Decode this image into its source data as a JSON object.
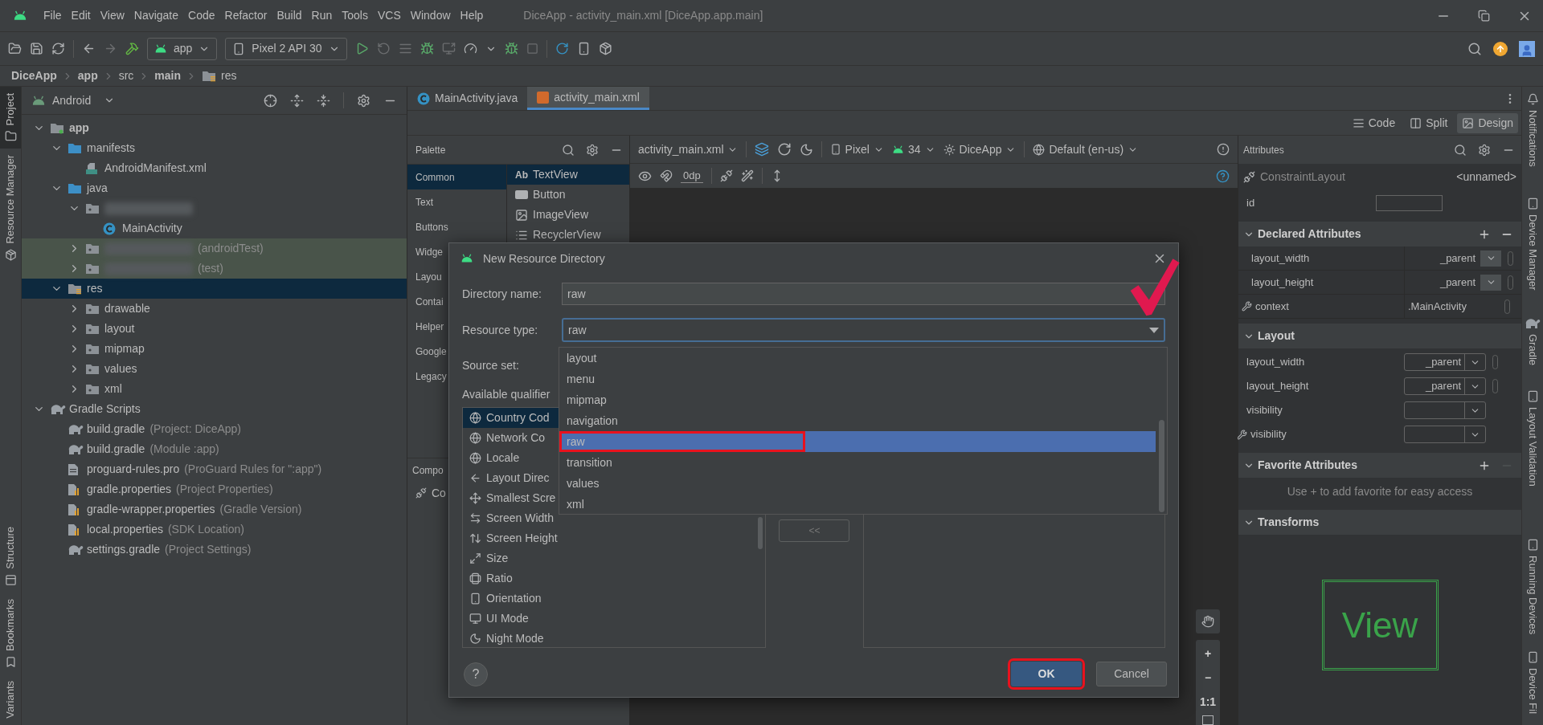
{
  "menu_bar": {
    "items": [
      "File",
      "Edit",
      "View",
      "Navigate",
      "Code",
      "Refactor",
      "Build",
      "Run",
      "Tools",
      "VCS",
      "Window",
      "Help"
    ],
    "title": "DiceApp - activity_main.xml [DiceApp.app.main]"
  },
  "toolbar": {
    "run_config": "app",
    "device": "Pixel 2 API 30"
  },
  "breadcrumb": [
    {
      "label": "DiceApp",
      "bold": true
    },
    {
      "label": "app",
      "bold": true
    },
    {
      "label": "src",
      "bold": false
    },
    {
      "label": "main",
      "bold": true
    },
    {
      "label": "res",
      "bold": false
    }
  ],
  "left_strip": {
    "top": [
      {
        "label": "Project",
        "selected": true
      },
      {
        "label": "Resource Manager",
        "selected": false
      }
    ],
    "bottom": [
      {
        "label": "Structure",
        "selected": false
      },
      {
        "label": "Bookmarks",
        "selected": false
      },
      {
        "label": "Variants",
        "selected": false
      }
    ]
  },
  "project": {
    "view": "Android",
    "tree": [
      {
        "label": "app",
        "kind": "module",
        "expanded": true,
        "selected": false,
        "tinted": false,
        "children": [
          {
            "label": "manifests",
            "kind": "folder",
            "expanded": true,
            "selected": false,
            "tinted": false,
            "children": [
              {
                "label": "AndroidManifest.xml",
                "kind": "manifest",
                "selected": false,
                "tinted": false
              }
            ]
          },
          {
            "label": "java",
            "kind": "folder",
            "expanded": true,
            "selected": false,
            "tinted": false,
            "children": [
              {
                "kind": "package",
                "expanded": true,
                "selected": false,
                "tinted": false,
                "children": [
                  {
                    "label": "MainActivity",
                    "kind": "class",
                    "selected": false,
                    "tinted": false
                  }
                ]
              },
              {
                "kind": "package",
                "note": "(androidTest)",
                "expanded": false,
                "selected": false,
                "tinted": true
              },
              {
                "kind": "package",
                "note": "(test)",
                "expanded": false,
                "selected": false,
                "tinted": true
              }
            ]
          },
          {
            "label": "res",
            "kind": "res",
            "expanded": true,
            "selected": true,
            "tinted": false,
            "children": [
              {
                "label": "drawable",
                "kind": "dir",
                "expanded": false,
                "selected": false,
                "tinted": false
              },
              {
                "label": "layout",
                "kind": "dir",
                "expanded": false,
                "selected": false,
                "tinted": false
              },
              {
                "label": "mipmap",
                "kind": "dir",
                "expanded": false,
                "selected": false,
                "tinted": false
              },
              {
                "label": "values",
                "kind": "dir",
                "expanded": false,
                "selected": false,
                "tinted": false
              },
              {
                "label": "xml",
                "kind": "dir",
                "expanded": false,
                "selected": false,
                "tinted": false
              }
            ]
          }
        ]
      },
      {
        "label": "Gradle Scripts",
        "kind": "gradle",
        "expanded": true,
        "selected": false,
        "tinted": false,
        "children": [
          {
            "label": "build.gradle",
            "note": "(Project: DiceApp)",
            "kind": "gradle",
            "selected": false,
            "tinted": false
          },
          {
            "label": "build.gradle",
            "note": "(Module :app)",
            "kind": "gradle",
            "selected": false,
            "tinted": false
          },
          {
            "label": "proguard-rules.pro",
            "note": "(ProGuard Rules for \":app\")",
            "kind": "file",
            "selected": false,
            "tinted": false
          },
          {
            "label": "gradle.properties",
            "note": "(Project Properties)",
            "kind": "props",
            "selected": false,
            "tinted": false
          },
          {
            "label": "gradle-wrapper.properties",
            "note": "(Gradle Version)",
            "kind": "props",
            "selected": false,
            "tinted": false
          },
          {
            "label": "local.properties",
            "note": "(SDK Location)",
            "kind": "props",
            "selected": false,
            "tinted": false
          },
          {
            "label": "settings.gradle",
            "note": "(Project Settings)",
            "kind": "gradle",
            "selected": false,
            "tinted": false
          }
        ]
      }
    ]
  },
  "editor_tabs": [
    {
      "label": "MainActivity.java",
      "kind": "java",
      "selected": false
    },
    {
      "label": "activity_main.xml",
      "kind": "xml",
      "selected": true
    }
  ],
  "view_modes": [
    {
      "label": "Code",
      "kind": "code",
      "selected": false
    },
    {
      "label": "Split",
      "kind": "split",
      "selected": false
    },
    {
      "label": "Design",
      "kind": "design",
      "selected": true
    }
  ],
  "palette": {
    "title": "Palette",
    "categories": [
      {
        "label": "Common",
        "selected": true
      },
      {
        "label": "Text",
        "selected": false
      },
      {
        "label": "Buttons",
        "selected": false
      },
      {
        "label": "Widge",
        "selected": false
      },
      {
        "label": "Layou",
        "selected": false
      },
      {
        "label": "Contai",
        "selected": false
      },
      {
        "label": "Helper",
        "selected": false
      },
      {
        "label": "Google",
        "selected": false
      },
      {
        "label": "Legacy",
        "selected": false
      }
    ],
    "items": [
      {
        "label": "TextView",
        "kind": "text",
        "prefix": "Ab",
        "selected": true
      },
      {
        "label": "Button",
        "kind": "button",
        "selected": false
      },
      {
        "label": "ImageView",
        "kind": "image",
        "selected": false
      },
      {
        "label": "RecyclerView",
        "kind": "list",
        "selected": false
      }
    ]
  },
  "component_tree": {
    "title": "Compo",
    "items": [
      "Co"
    ]
  },
  "design_toolbar": {
    "file": "activity_main.xml",
    "device": "Pixel",
    "api": "34",
    "theme": "DiceApp",
    "locale": "Default (en-us)",
    "margin": "0dp"
  },
  "zoom_controls": [
    "+",
    "−",
    "1:1"
  ],
  "attributes": {
    "title": "Attributes",
    "component": "ConstraintLayout",
    "name": "<unnamed>",
    "id_label": "id",
    "sections": [
      {
        "title": "Declared Attributes",
        "actions": true,
        "remove_enabled": true,
        "rows": [
          {
            "label": "layout_width",
            "value": "_parent",
            "kind": "flat",
            "tool": false
          },
          {
            "label": "layout_height",
            "value": "_parent",
            "kind": "flat",
            "tool": false
          },
          {
            "label": "context",
            "value": ".MainActivity",
            "kind": "text",
            "tool": true
          }
        ]
      },
      {
        "title": "Layout",
        "rows": [
          {
            "label": "layout_width",
            "value": "_parent",
            "kind": "combo",
            "tool": false
          },
          {
            "label": "layout_height",
            "value": "_parent",
            "kind": "combo",
            "tool": false
          },
          {
            "label": "visibility",
            "kind": "combo",
            "tool": false
          },
          {
            "label": "visibility",
            "kind": "combo",
            "tool": true
          }
        ]
      },
      {
        "title": "Favorite Attributes",
        "actions": true,
        "remove_enabled": false,
        "hint": "Use + to add favorite for easy access"
      },
      {
        "title": "Transforms",
        "preview": "View"
      }
    ]
  },
  "right_strip": [
    "Notifications",
    "Device Manager",
    "Gradle",
    "Layout Validation",
    "Running Devices",
    "Device Fil"
  ],
  "dialog": {
    "title": "New Resource Directory",
    "directory_label": "Directory name:",
    "directory_value": "raw",
    "type_label": "Resource type:",
    "type_value": "raw",
    "source_label": "Source set:",
    "qualifiers_label": "Available qualifier",
    "checkmark": true,
    "qualifiers": [
      {
        "label": "Country Cod",
        "selected": true
      },
      {
        "label": "Network Co",
        "selected": false
      },
      {
        "label": "Locale",
        "selected": false
      },
      {
        "label": "Layout Direc",
        "selected": false
      },
      {
        "label": "Smallest Scre",
        "selected": false
      },
      {
        "label": "Screen Width",
        "selected": false
      },
      {
        "label": "Screen Height",
        "selected": false
      },
      {
        "label": "Size",
        "selected": false
      },
      {
        "label": "Ratio",
        "selected": false
      },
      {
        "label": "Orientation",
        "selected": false
      },
      {
        "label": "UI Mode",
        "selected": false
      },
      {
        "label": "Night Mode",
        "selected": false
      }
    ],
    "move_left": {
      "label": "<<",
      "disabled": true
    },
    "help": "?",
    "type_options": [
      {
        "label": "layout",
        "selected": false,
        "annotated": false
      },
      {
        "label": "menu",
        "selected": false,
        "annotated": false
      },
      {
        "label": "mipmap",
        "selected": false,
        "annotated": false
      },
      {
        "label": "navigation",
        "selected": false,
        "annotated": false
      },
      {
        "label": "raw",
        "selected": true,
        "annotated": true
      },
      {
        "label": "transition",
        "selected": false,
        "annotated": false
      },
      {
        "label": "values",
        "selected": false,
        "annotated": false
      },
      {
        "label": "xml",
        "selected": false,
        "annotated": false
      }
    ],
    "buttons": [
      {
        "label": "OK",
        "primary": true,
        "annotated": true
      },
      {
        "label": "Cancel",
        "primary": false,
        "annotated": false
      }
    ]
  }
}
